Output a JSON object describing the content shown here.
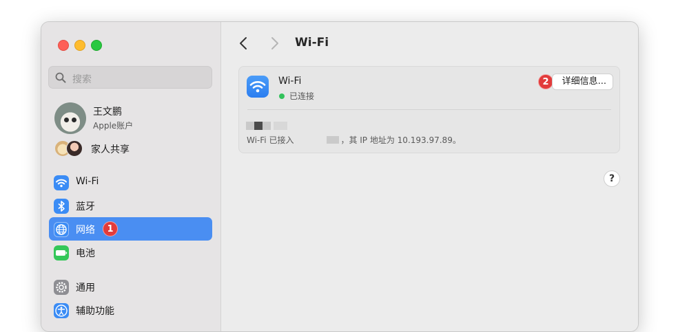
{
  "sidebar": {
    "search_placeholder": "搜索",
    "profile": {
      "name": "王文鹏",
      "subtitle": "Apple账户"
    },
    "family_label": "家人共享",
    "items": [
      {
        "label": "Wi-Fi",
        "icon": "wifi-icon",
        "color": "#3b8cf5",
        "selected": false
      },
      {
        "label": "蓝牙",
        "icon": "bluetooth-icon",
        "color": "#3b8cf5",
        "selected": false
      },
      {
        "label": "网络",
        "icon": "globe-icon",
        "color": "#3b8cf5",
        "selected": true,
        "badge": "1"
      },
      {
        "label": "电池",
        "icon": "battery-icon",
        "color": "#34c759",
        "selected": false
      },
      {
        "label": "通用",
        "icon": "gear-icon",
        "color": "#8e8e93",
        "selected": false
      },
      {
        "label": "辅助功能",
        "icon": "accessibility-icon",
        "color": "#3b8cf5",
        "selected": false
      }
    ]
  },
  "main": {
    "title": "Wi-Fi",
    "wifi_card": {
      "name": "Wi-Fi",
      "status": "已连接",
      "details_button": "详细信息...",
      "details_badge": "2",
      "info_prefix": "Wi-Fi 已接入",
      "info_suffix": "，其 IP 地址为 10.193.97.89。"
    },
    "help_label": "?"
  },
  "colors": {
    "accent": "#4a8ef2",
    "badge": "#e23b3b",
    "connected": "#32c25b"
  }
}
